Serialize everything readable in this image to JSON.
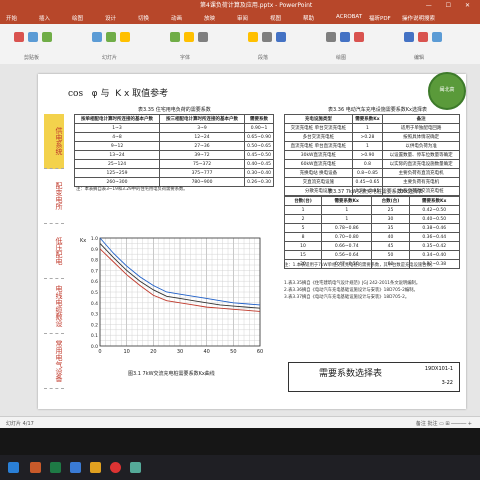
{
  "window": {
    "title": "第4课负荷计算及应用.pptx - PowerPoint",
    "controls": "— ☐ ✕"
  },
  "ribbon": {
    "tabs": [
      "开始",
      "插入",
      "绘图",
      "设计",
      "切换",
      "动画",
      "放映",
      "审阅",
      "视图",
      "帮助",
      "ACROBAT",
      "福昕PDF",
      "操作说明搜索"
    ],
    "groups": [
      "剪贴板",
      "幻灯片",
      "字体",
      "段落",
      "绘图",
      "编辑"
    ]
  },
  "slide": {
    "heading": {
      "cos": "cos",
      "phi": "φ 与",
      "k": "K",
      "rest": "x 取值参考"
    },
    "logo_text": "闽北高",
    "side_nav": [
      "供电系统",
      "配变电所",
      "低压配电",
      "电线电缆敷设",
      "常用电气设备"
    ],
    "side_nav_active": 0,
    "table_335": {
      "caption": "表3.35 住宅用电负荷的需要系数",
      "headers": [
        "按单相配电计算时所连接的基本户数",
        "按三相配电计算时所连接的基本户数",
        "需要系数"
      ],
      "rows": [
        [
          "1~3",
          "3~9",
          "0.90~1"
        ],
        [
          "4~8",
          "12~24",
          "0.65~0.90"
        ],
        [
          "9~12",
          "27~36",
          "0.50~0.65"
        ],
        [
          "13~24",
          "39~72",
          "0.45~0.50"
        ],
        [
          "25~124",
          "75~372",
          "0.40~0.45"
        ],
        [
          "125~259",
          "375~777",
          "0.30~0.40"
        ],
        [
          "260~300",
          "780~900",
          "0.26~0.30"
        ]
      ],
      "note": "注：本表摘自表3~19和3.29中的住宅用电负荷需要系数。"
    },
    "table_336": {
      "caption": "表3.36 电动汽车充电设施需要系数Kx选择表",
      "headers": [
        "充电设施类型",
        "需要系数Kx",
        "备注"
      ],
      "rows": [
        [
          "交流充电桩 单台交流充电桩",
          "1",
          "适用于单独配电回路"
        ],
        [
          "多台交流充电桩",
          ">0.28",
          "按照具体情况确定"
        ],
        [
          "直流充电桩 单台直流充电桩",
          "1",
          "以供电负荷为准"
        ],
        [
          "30kW直流充电桩",
          ">0.90",
          "以设置数量、停车位数量等确定"
        ],
        [
          "60kW直流充电桩",
          "0.8",
          "以实际的直流充电设施数量确定"
        ],
        [
          "充换电站 换电设备",
          "0.8~0.85",
          "主要负荷有直流充电机"
        ],
        [
          "交直流充电设施",
          "0.45~0.65",
          "主要负荷有充电机"
        ],
        [
          "分散充电设施",
          "0.28~0.35",
          "主要负荷有交流充电桩"
        ]
      ]
    },
    "table_337": {
      "caption": "表3.37 7kW交流充电桩需要系数Kx选择表",
      "headers": [
        "台数(台)",
        "需要系数Kx",
        "台数(台)",
        "需要系数Kx"
      ],
      "rows": [
        [
          "1",
          "1",
          "25",
          "0.42~0.50"
        ],
        [
          "2",
          "1",
          "30",
          "0.40~0.50"
        ],
        [
          "5",
          "0.78~0.86",
          "35",
          "0.38~0.46"
        ],
        [
          "8",
          "0.70~0.80",
          "40",
          "0.36~0.44"
        ],
        [
          "10",
          "0.66~0.74",
          "45",
          "0.35~0.42"
        ],
        [
          "15",
          "0.56~0.64",
          "50",
          "0.34~0.40"
        ],
        [
          "20",
          "0.47~0.56",
          "60",
          "0.32~0.38"
        ]
      ],
      "note": "注：1.本表适用于7kW单相交流充电桩的需要系数，其中台数是充电设施台数。"
    },
    "sources": [
      "1.表3.35摘自《住宅建筑电气设计规范》JGJ 242-2011条文说明编制。",
      "2.表3.36摘自《电动汽车充电基础设施设计与安装》18D705-2编制。",
      "3.表3.37摘自《电动汽车充电基础设施设计与安装》18D705-2。"
    ],
    "chart_caption": "图3.1 7kW交流充电桩需要系数Kx曲线",
    "bottom_title": "需要系数选择表",
    "bottom_code": "19DX101-1",
    "bottom_page": "3-22"
  },
  "chart_data": {
    "type": "line",
    "title": "",
    "xlabel": "",
    "ylabel": "Kx",
    "xlim": [
      0,
      60
    ],
    "ylim": [
      0,
      1.0
    ],
    "x_ticks": [
      0,
      10,
      20,
      30,
      40,
      50,
      60
    ],
    "y_ticks": [
      0,
      0.1,
      0.2,
      0.3,
      0.4,
      0.5,
      0.6,
      0.7,
      0.8,
      0.9,
      1.0
    ],
    "grid": true,
    "series": [
      {
        "name": "",
        "color": "#1f5fc8",
        "x": [
          0,
          5,
          10,
          15,
          20,
          25,
          30,
          35,
          40,
          45,
          50,
          55,
          60
        ],
        "y": [
          1.0,
          0.86,
          0.74,
          0.64,
          0.56,
          0.5,
          0.48,
          0.46,
          0.44,
          0.42,
          0.4,
          0.39,
          0.38
        ]
      },
      {
        "name": "",
        "color": "#333333",
        "x": [
          0,
          5,
          10,
          15,
          20,
          25,
          30,
          35,
          40,
          45,
          50,
          55,
          60
        ],
        "y": [
          0.95,
          0.82,
          0.7,
          0.6,
          0.52,
          0.46,
          0.44,
          0.42,
          0.4,
          0.38,
          0.37,
          0.36,
          0.35
        ]
      },
      {
        "name": "",
        "color": "#c0392b",
        "x": [
          0,
          5,
          10,
          15,
          20,
          25,
          30,
          35,
          40,
          45,
          50,
          55,
          60
        ],
        "y": [
          0.9,
          0.78,
          0.66,
          0.56,
          0.47,
          0.42,
          0.4,
          0.38,
          0.36,
          0.35,
          0.34,
          0.33,
          0.32
        ]
      }
    ]
  },
  "status": {
    "left": "幻灯片 4/17",
    "right": "备注  批注  ▭  ⊞  ─────  +"
  },
  "taskbar": {
    "time": "",
    "date": ""
  }
}
